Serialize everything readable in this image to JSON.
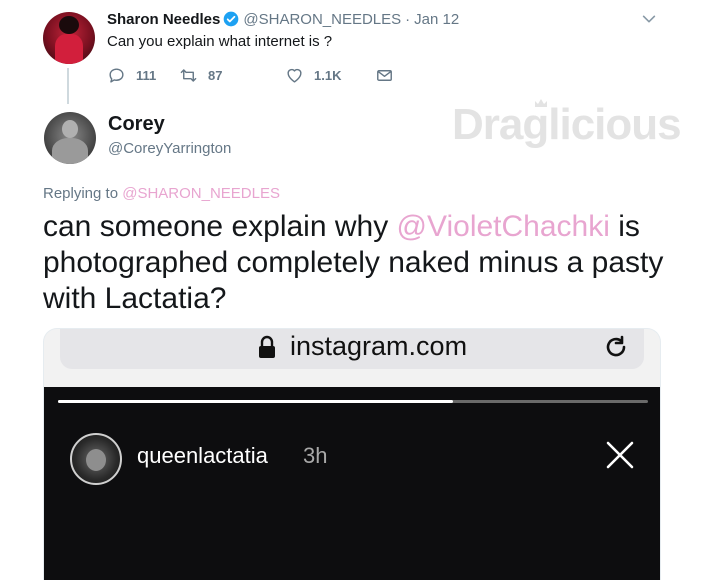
{
  "original_tweet": {
    "display_name": "Sharon Needles",
    "handle": "@SHARON_NEEDLES",
    "separator": "·",
    "date": "Jan 12",
    "text": "Can you explain what internet is ?",
    "replies": "111",
    "retweets": "87",
    "likes": "1.1K"
  },
  "reply_tweet": {
    "display_name": "Corey",
    "handle": "@CoreyYarrington",
    "replying_prefix": "Replying to",
    "replying_to": "@SHARON_NEEDLES",
    "text_part1": "can someone explain why ",
    "text_mention": "@VioletChachki",
    "text_part2": " is photographed completely naked minus a pasty with Lactatia?"
  },
  "watermark": {
    "text": "Draglicious"
  },
  "embedded_screenshot": {
    "url": "instagram.com",
    "story_username": "queenlactatia",
    "story_time": "3h",
    "story_progress": 0.67
  },
  "colors": {
    "accent_mention": "#e8a5d0",
    "secondary_text": "#657786",
    "verified": "#1da1f2"
  },
  "icons": [
    "verified-badge-icon",
    "chevron-down-icon",
    "reply-icon",
    "retweet-icon",
    "like-icon",
    "direct-message-icon",
    "lock-icon",
    "reload-icon",
    "close-icon",
    "crown-icon"
  ]
}
